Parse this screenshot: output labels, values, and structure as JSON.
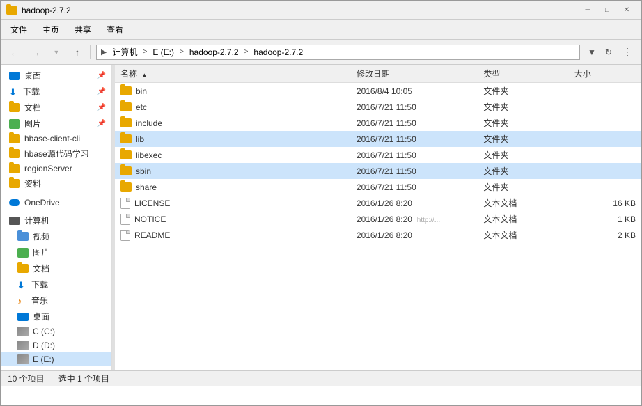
{
  "titlebar": {
    "title": "hadoop-2.7.2",
    "minimize": "─",
    "maximize": "□",
    "close": "✕"
  },
  "menubar": {
    "items": [
      "文件",
      "主页",
      "共享",
      "查看"
    ]
  },
  "toolbar": {
    "back_tooltip": "后退",
    "forward_tooltip": "前进",
    "up_tooltip": "向上",
    "recent_tooltip": "最近位置"
  },
  "addressbar": {
    "segments": [
      "计算机",
      "E (E:)",
      "hadoop-2.7.2",
      "hadoop-2.7.2"
    ],
    "refresh_tooltip": "刷新"
  },
  "sidebar": {
    "pinned_items": [
      {
        "label": "桌面",
        "type": "desktop",
        "pinned": true
      },
      {
        "label": "下载",
        "type": "download",
        "pinned": true
      },
      {
        "label": "文档",
        "type": "folder",
        "pinned": true
      },
      {
        "label": "图片",
        "type": "image",
        "pinned": true
      }
    ],
    "quick_access": [
      {
        "label": "hbase-client-cli",
        "type": "folder"
      },
      {
        "label": "hbase源代码学习",
        "type": "folder"
      },
      {
        "label": "regionServer",
        "type": "folder"
      },
      {
        "label": "资料",
        "type": "folder"
      }
    ],
    "onedrive": {
      "label": "OneDrive",
      "type": "onedrive"
    },
    "computer_section": {
      "label": "计算机",
      "items": [
        {
          "label": "视频",
          "type": "folder-blue"
        },
        {
          "label": "图片",
          "type": "folder-blue"
        },
        {
          "label": "文档",
          "type": "folder-blue"
        },
        {
          "label": "下载",
          "type": "download"
        },
        {
          "label": "音乐",
          "type": "music"
        },
        {
          "label": "桌面",
          "type": "desktop"
        },
        {
          "label": "C (C:)",
          "type": "drive"
        },
        {
          "label": "D (D:)",
          "type": "drive"
        },
        {
          "label": "E (E:)",
          "type": "drive",
          "selected": true
        }
      ]
    }
  },
  "file_table": {
    "columns": [
      "名称",
      "修改日期",
      "类型",
      "大小"
    ],
    "sort_column": "名称",
    "sort_direction": "asc",
    "rows": [
      {
        "name": "bin",
        "date": "2016/8/4 10:05",
        "type": "文件夹",
        "size": "",
        "is_folder": true,
        "selected": false
      },
      {
        "name": "etc",
        "date": "2016/7/21 11:50",
        "type": "文件夹",
        "size": "",
        "is_folder": true,
        "selected": false
      },
      {
        "name": "include",
        "date": "2016/7/21 11:50",
        "type": "文件夹",
        "size": "",
        "is_folder": true,
        "selected": false
      },
      {
        "name": "lib",
        "date": "2016/7/21 11:50",
        "type": "文件夹",
        "size": "",
        "is_folder": true,
        "selected": true
      },
      {
        "name": "libexec",
        "date": "2016/7/21 11:50",
        "type": "文件夹",
        "size": "",
        "is_folder": true,
        "selected": false
      },
      {
        "name": "sbin",
        "date": "2016/7/21 11:50",
        "type": "文件夹",
        "size": "",
        "is_folder": true,
        "selected": true
      },
      {
        "name": "share",
        "date": "2016/7/21 11:50",
        "type": "文件夹",
        "size": "",
        "is_folder": true,
        "selected": false
      },
      {
        "name": "LICENSE",
        "date": "2016/1/26 8:20",
        "type": "文本文档",
        "size": "16 KB",
        "is_folder": false,
        "selected": false
      },
      {
        "name": "NOTICE",
        "date": "2016/1/26 8:20",
        "type": "文本文档",
        "size": "1 KB",
        "is_folder": false,
        "selected": false
      },
      {
        "name": "README",
        "date": "2016/1/26 8:20",
        "type": "文本文档",
        "size": "2 KB",
        "is_folder": false,
        "selected": false
      }
    ]
  },
  "statusbar": {
    "item_count": "10 个项目",
    "selected_count": "选中 1 个项目"
  },
  "watermark": "http://..."
}
